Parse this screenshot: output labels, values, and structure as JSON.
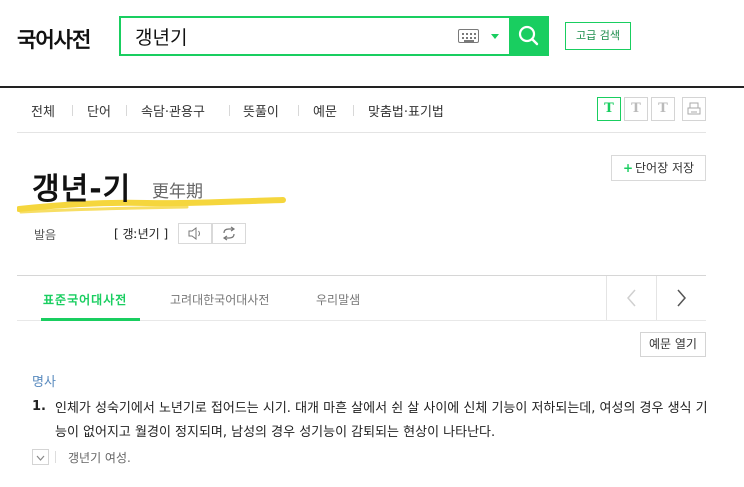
{
  "header": {
    "brand": "국어사전",
    "search": {
      "value": "갱년기",
      "icon": "keyboard-icon"
    },
    "advanced_search_label": "고급 검색"
  },
  "category_nav": {
    "items": [
      "전체",
      "단어",
      "속담·관용구",
      "뜻풀이",
      "예문",
      "맞춤법·표기법"
    ],
    "font_size_buttons": [
      "T",
      "T",
      "T"
    ]
  },
  "entry": {
    "title": "갱년-기",
    "hanja": "更年期",
    "save_label": "단어장 저장",
    "pronunciation_label": "발음",
    "pronunciation": "[ 갱ː년기 ]"
  },
  "dict_tabs": {
    "items": [
      "표준국어대사전",
      "고려대한국어대사전",
      "우리말샘"
    ],
    "active": "표준국어대사전"
  },
  "definitions": {
    "examples_button": "예문 열기",
    "part_of_speech": "명사",
    "items": [
      {
        "number": "1.",
        "text": "인체가 성숙기에서 노년기로 접어드는 시기. 대개 마흔 살에서 쉰 살 사이에 신체 기능이 저하되는데, 여성의 경우 생식 기능이 없어지고 월경이 정지되며, 남성의 경우 성기능이 감퇴되는 현상이 나타난다.",
        "example": "갱년기 여성."
      }
    ]
  },
  "colors": {
    "accent": "#19ce60",
    "highlight": "#f5d63d",
    "pos": "#5a8bbf"
  }
}
